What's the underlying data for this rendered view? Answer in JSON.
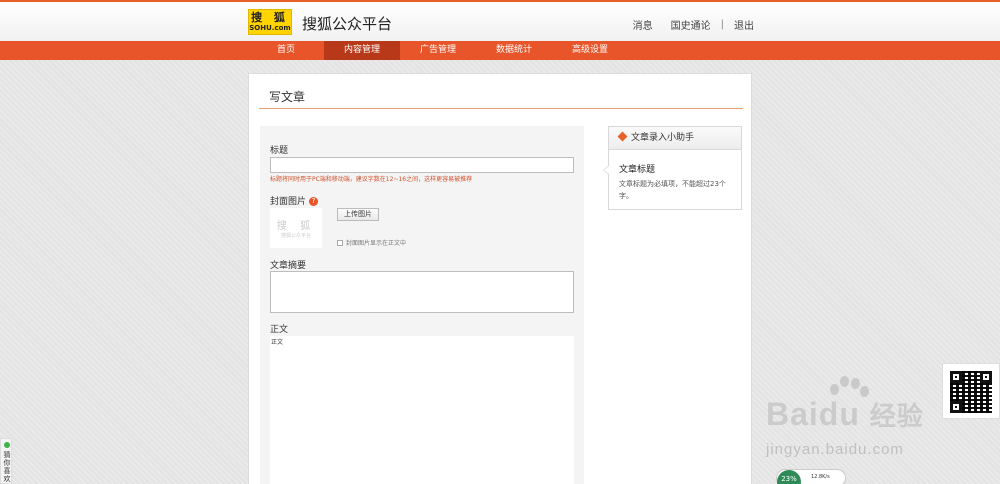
{
  "header": {
    "logo_text": "搜 狐",
    "logo_sub": "SOHU.com",
    "platform_title": "搜狐公众平台",
    "links": [
      "消息",
      "国史通论",
      "退出"
    ],
    "separator": "|"
  },
  "nav": {
    "items": [
      {
        "label": "首页"
      },
      {
        "label": "内容管理"
      },
      {
        "label": "广告管理"
      },
      {
        "label": "数据统计"
      },
      {
        "label": "高级设置"
      }
    ],
    "active_index": 1
  },
  "editor": {
    "page_title": "写文章",
    "title_label": "标题",
    "title_value": "",
    "title_hint": "标题将同时用于PC端和移动端，建议字数在12~16之间，这样更容易被推荐",
    "cover_label": "封面图片",
    "help_icon": "?",
    "cover_thumb_text": "搜 狐",
    "cover_thumb_sub": "搜狐公众平台",
    "upload_label": "上传图片",
    "cover_checkbox_label": "封面图片显示在正文中",
    "summary_label": "文章摘要",
    "summary_value": "",
    "body_label": "正文",
    "body_placeholder": "正文"
  },
  "helper": {
    "title": "文章录入小助手",
    "subtitle": "文章标题",
    "text": "文章标题为必填项，不能超过23个字。"
  },
  "side_tab": {
    "label": "猜你喜欢"
  },
  "watermark": {
    "brand": "Bai",
    "brand2": "du",
    "cn": "经验",
    "url": "jingyan.baidu.com"
  },
  "speed_widget": {
    "percent": "23%",
    "speed": "12.8K/s"
  },
  "colors": {
    "accent": "#e8552a",
    "nav_active": "#b8391a",
    "hint_red": "#d2502a"
  }
}
